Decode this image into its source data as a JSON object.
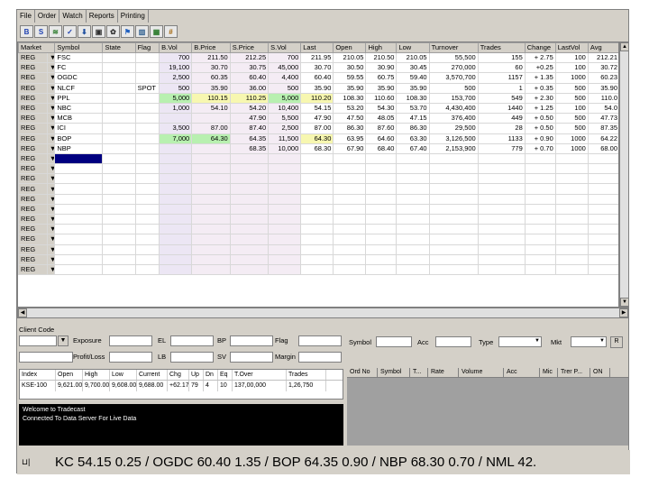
{
  "menu": [
    "File",
    "Order",
    "Watch",
    "Reports",
    "Printing"
  ],
  "toolbar": [
    {
      "name": "buy-icon",
      "glyph": "B",
      "color": "#1c3fb0"
    },
    {
      "name": "sell-icon",
      "glyph": "S",
      "color": "#1c3fb0"
    },
    {
      "name": "chart-icon",
      "glyph": "≋",
      "color": "#2a7a2a"
    },
    {
      "name": "check-icon",
      "glyph": "✓",
      "color": "#1c3fb0"
    },
    {
      "name": "download-icon",
      "glyph": "⬇",
      "color": "#2050a0"
    },
    {
      "name": "monitor-icon",
      "glyph": "▣",
      "color": "#303030"
    },
    {
      "name": "gear-icon",
      "glyph": "✿",
      "color": "#303030"
    },
    {
      "name": "people-icon",
      "glyph": "⚑",
      "color": "#2060c0"
    },
    {
      "name": "bars-icon",
      "glyph": "▥",
      "color": "#306090"
    },
    {
      "name": "grid-icon",
      "glyph": "▦",
      "color": "#2a7a2a"
    },
    {
      "name": "calc-icon",
      "glyph": "#",
      "color": "#a06000"
    }
  ],
  "columns": [
    "Market",
    "Symbol",
    "State",
    "Flag",
    "B.Vol",
    "B.Price",
    "S.Price",
    "S.Vol",
    "Last",
    "Open",
    "High",
    "Low",
    "Turnover",
    "Trades",
    "Change",
    "LastVol",
    "Avg"
  ],
  "rows": [
    {
      "market": "REG",
      "symbol": "FSC",
      "state": "",
      "flag": "",
      "bvol": "700",
      "bprice": "211.50",
      "sprice": "212.25",
      "svol": "700",
      "last": "211.95",
      "open": "210.05",
      "high": "210.50",
      "low": "210.05",
      "turnover": "55,500",
      "trades": "155",
      "change": "+ 2.75",
      "lastvol": "100",
      "avg": "212.21",
      "hl": ""
    },
    {
      "market": "REG",
      "symbol": "FC",
      "state": "",
      "flag": "",
      "bvol": "19,100",
      "bprice": "30.70",
      "sprice": "30.75",
      "svol": "45,000",
      "last": "30.70",
      "open": "30.50",
      "high": "30.90",
      "low": "30.45",
      "turnover": "270,000",
      "trades": "60",
      "change": "+0.25",
      "lastvol": "100",
      "avg": "30.72",
      "hl": ""
    },
    {
      "market": "REG",
      "symbol": "OGDC",
      "state": "",
      "flag": "",
      "bvol": "2,500",
      "bprice": "60.35",
      "sprice": "60.40",
      "svol": "4,400",
      "last": "60.40",
      "open": "59.55",
      "high": "60.75",
      "low": "59.40",
      "turnover": "3,570,700",
      "trades": "1157",
      "change": "+ 1.35",
      "lastvol": "1000",
      "avg": "60.23",
      "hl": ""
    },
    {
      "market": "REG",
      "symbol": "NLCF",
      "state": "",
      "flag": "SPOT",
      "bvol": "500",
      "bprice": "35.90",
      "sprice": "36.00",
      "svol": "500",
      "last": "35.90",
      "open": "35.90",
      "high": "35.90",
      "low": "35.90",
      "turnover": "500",
      "trades": "1",
      "change": "+ 0.35",
      "lastvol": "500",
      "avg": "35.90",
      "hl": ""
    },
    {
      "market": "REG",
      "symbol": "PPL",
      "state": "",
      "flag": "",
      "bvol": "5,000",
      "bprice": "110.15",
      "sprice": "110.25",
      "svol": "5,000",
      "last": "110.20",
      "open": "108.30",
      "high": "110.60",
      "low": "108.30",
      "turnover": "153,700",
      "trades": "549",
      "change": "+ 2.30",
      "lastvol": "500",
      "avg": "110.0",
      "hl": "green-yellow"
    },
    {
      "market": "REG",
      "symbol": "NBC",
      "state": "",
      "flag": "",
      "bvol": "1,000",
      "bprice": "54.10",
      "sprice": "54.20",
      "svol": "10,400",
      "last": "54.15",
      "open": "53.20",
      "high": "54.30",
      "low": "53.70",
      "turnover": "4,430,400",
      "trades": "1440",
      "change": "+ 1.25",
      "lastvol": "100",
      "avg": "54.0",
      "hl": ""
    },
    {
      "market": "REG",
      "symbol": "MCB",
      "state": "",
      "flag": "",
      "bvol": "",
      "bprice": "",
      "sprice": "47.90",
      "svol": "5,500",
      "last": "47.90",
      "open": "47.50",
      "high": "48.05",
      "low": "47.15",
      "turnover": "376,400",
      "trades": "449",
      "change": "+ 0.50",
      "lastvol": "500",
      "avg": "47.73",
      "hl": ""
    },
    {
      "market": "REG",
      "symbol": "ICI",
      "state": "",
      "flag": "",
      "bvol": "3,500",
      "bprice": "87.00",
      "sprice": "87.40",
      "svol": "2,500",
      "last": "87.00",
      "open": "86.30",
      "high": "87.60",
      "low": "86.30",
      "turnover": "29,500",
      "trades": "28",
      "change": "+ 0.50",
      "lastvol": "500",
      "avg": "87.35",
      "hl": ""
    },
    {
      "market": "REG",
      "symbol": "BOP",
      "state": "",
      "flag": "",
      "bvol": "7,000",
      "bprice": "64.30",
      "sprice": "64.35",
      "svol": "11,500",
      "last": "64.30",
      "open": "63.95",
      "high": "64.60",
      "low": "63.30",
      "turnover": "3,126,500",
      "trades": "1133",
      "change": "+ 0.90",
      "lastvol": "1000",
      "avg": "64.22",
      "hl": "green-last"
    },
    {
      "market": "REG",
      "symbol": "NBP",
      "state": "",
      "flag": "",
      "bvol": "",
      "bprice": "",
      "sprice": "68.35",
      "svol": "10,000",
      "last": "68.30",
      "open": "67.90",
      "high": "68.40",
      "low": "67.40",
      "turnover": "2,153,900",
      "trades": "779",
      "change": "+ 0.70",
      "lastvol": "1000",
      "avg": "68.00",
      "hl": ""
    }
  ],
  "empty_rows": [
    "REG",
    "REG",
    "REG",
    "REG",
    "REG",
    "REG",
    "REG",
    "REG",
    "REG",
    "REG",
    "REG",
    "REG"
  ],
  "order": {
    "client_code": "Client Code",
    "exposure": "Exposure",
    "el": "EL",
    "bp": "BP",
    "flag": "Flag",
    "profit_loss": "Profit/Loss",
    "lb": "LB",
    "sv": "SV",
    "margin": "Margin"
  },
  "index_table": {
    "headers": [
      "Index",
      "Open",
      "High",
      "Low",
      "Current",
      "Chg",
      "Up",
      "Dn",
      "Eq",
      "T.Over",
      "Trades"
    ],
    "values": [
      "KSE-100",
      "9,621.00",
      "9,700.00",
      "9,608.00",
      "9,688.00",
      "+62.17",
      "79",
      "4",
      "10",
      "137,00,000",
      "1,26,750"
    ]
  },
  "log": [
    "Welcome to Tradecast",
    "Connected To Data Server For Live Data"
  ],
  "right_filter": {
    "symbol": "Symbol",
    "acc": "Acc",
    "type": "Type",
    "mkt": "Mkt",
    "r_button": "R"
  },
  "orders_columns": [
    "Ord No",
    "Symbol",
    "T...",
    "Rate",
    "Volume",
    "Acc",
    "Mic",
    "Trer P...",
    "ON"
  ],
  "ticker": "KC 54.15 0.25 / OGDC 60.40 1.35 / BOP 64.35 0.90 / NBP 68.30 0.70 / NML 42."
}
